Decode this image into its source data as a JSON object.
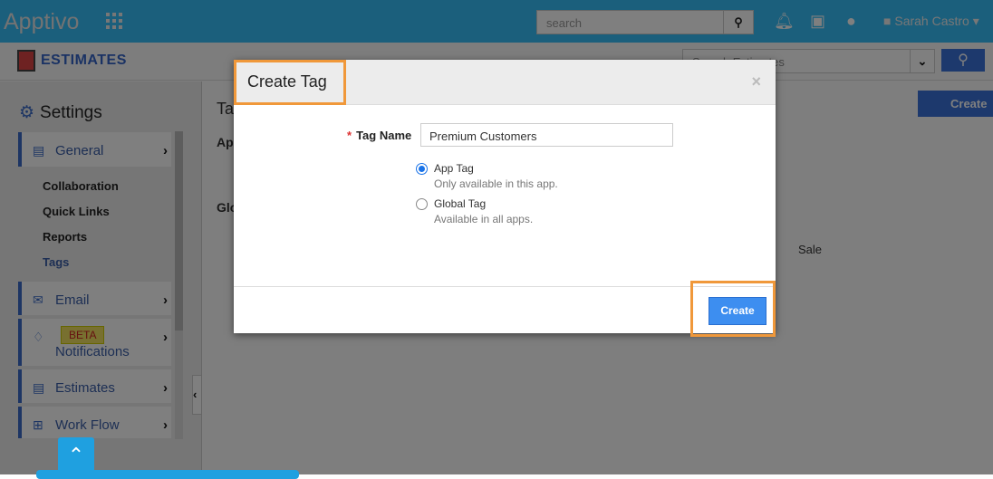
{
  "header": {
    "logo": "Apptivo",
    "search_placeholder": "search",
    "user": "Sarah Castro"
  },
  "subheader": {
    "app_title": "ESTIMATES",
    "search_placeholder": "Search Estimates"
  },
  "sidebar": {
    "title": "Settings",
    "items": [
      {
        "label": "General",
        "icon": "monitor-icon"
      },
      {
        "label": "Email",
        "icon": "envelope-icon"
      },
      {
        "label": "Notifications",
        "icon": "bell-icon",
        "badge": "BETA"
      },
      {
        "label": "Estimates",
        "icon": "form-icon"
      },
      {
        "label": "Work Flow",
        "icon": "workflow-icon"
      }
    ],
    "sub_items": [
      "Collaboration",
      "Quick Links",
      "Reports",
      "Tags"
    ]
  },
  "background": {
    "page_title": "Ta",
    "app_tags": "Ap",
    "global_tags": "Glo",
    "sale": "Sale",
    "create": "Create"
  },
  "modal": {
    "title": "Create Tag",
    "tag_name_label": "Tag Name",
    "tag_name_value": "Premium Customers",
    "options": [
      {
        "label": "App Tag",
        "desc": "Only available in this app.",
        "selected": true
      },
      {
        "label": "Global Tag",
        "desc": "Available in all apps.",
        "selected": false
      }
    ],
    "create": "Create"
  },
  "colors": {
    "header": "#36bef8",
    "accent": "#3d8ef0",
    "highlight": "#f0983a"
  }
}
